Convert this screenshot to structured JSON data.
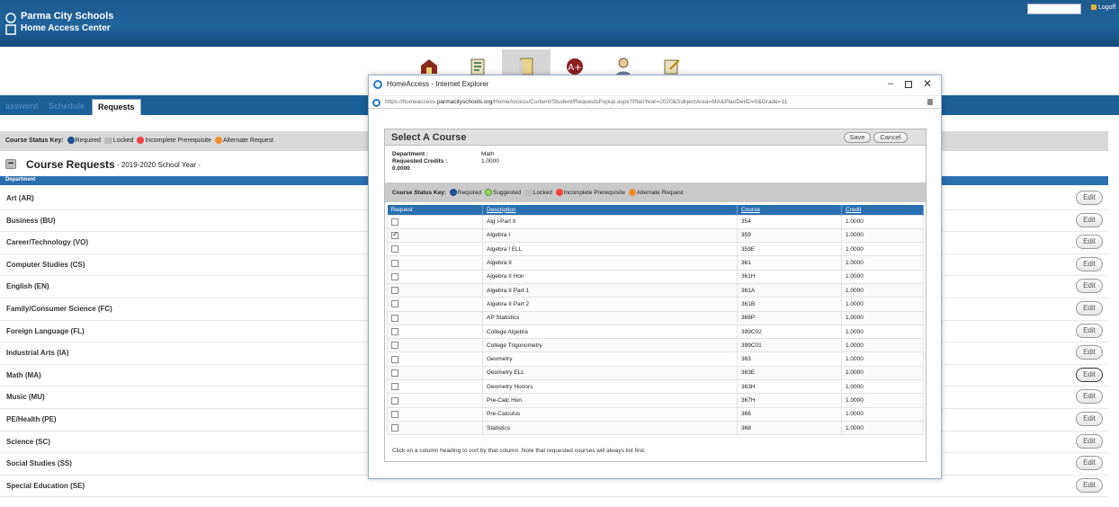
{
  "header": {
    "line1": "Parma City Schools",
    "line2": "Home Access Center",
    "logoff": "Logoff"
  },
  "nav": {
    "items": [
      "home-icon",
      "calendar-icon",
      "classes-icon",
      "grades-icon",
      "registration-icon",
      "requests-icon"
    ],
    "active_index": 2
  },
  "tabs": {
    "password": "assword",
    "schedule": "Schedule",
    "requests": "Requests"
  },
  "status_key": {
    "label": "Course Status Key:",
    "required": "Required",
    "locked": "Locked",
    "incomplete": "Incomplete Prerequisite",
    "alternate": "Alternate Request"
  },
  "course_requests": {
    "title": "Course Requests",
    "year": "- 2019-2020 School Year -",
    "column": "Department",
    "edit_label": "Edit",
    "departments": [
      "Art (AR)",
      "Business (BU)",
      "Career/Technology (VO)",
      "Computer Studies (CS)",
      "English (EN)",
      "Family/Consumer Science (FC)",
      "Foreign Language (FL)",
      "Industrial Arts (IA)",
      "Math (MA)",
      "Music (MU)",
      "PE/Health (PE)",
      "Science (SC)",
      "Social Studies (SS)",
      "Special Education (SE)"
    ]
  },
  "popup": {
    "window_title": "HomeAccess - Internet Explorer",
    "url_prefix": "https://homeaccess.",
    "url_domain": "parmacityschools.org",
    "url_rest": "/HomeAccess/Content/Student/RequestsPopup.aspx?PlanYear=2020&SubjectArea=MA&PlanDetID=0&Grade=11",
    "heading": "Select A Course",
    "save": "Save",
    "cancel": "Cancel",
    "department_label": "Department :",
    "department_value": "Math",
    "credits_label": "Requested Credits :",
    "credits_value": "1.0000",
    "credits_extra": "0.0000",
    "key": {
      "label": "Course Status Key:",
      "required": "Required",
      "suggested": "Suggested",
      "locked": "Locked",
      "incomplete": "Incomplete Prerequisite",
      "alternate": "Alternate Request"
    },
    "columns": [
      "Request",
      "Description",
      "Course",
      "Credit"
    ],
    "courses": [
      {
        "checked": false,
        "description": "Alg I-Part II",
        "course": "354",
        "credit": "1.0000"
      },
      {
        "checked": true,
        "description": "Algebra I",
        "course": "359",
        "credit": "1.0000"
      },
      {
        "checked": false,
        "description": "Algebra I ELL",
        "course": "359E",
        "credit": "1.0000"
      },
      {
        "checked": false,
        "description": "Algebra II",
        "course": "361",
        "credit": "1.0000"
      },
      {
        "checked": false,
        "description": "Algebra II Hon",
        "course": "361H",
        "credit": "1.0000"
      },
      {
        "checked": false,
        "description": "Algebra II Part 1",
        "course": "361A",
        "credit": "1.0000"
      },
      {
        "checked": false,
        "description": "Algebra II Part 2",
        "course": "361B",
        "credit": "1.0000"
      },
      {
        "checked": false,
        "description": "AP Statistics",
        "course": "368P",
        "credit": "1.0000"
      },
      {
        "checked": false,
        "description": "College Algebra",
        "course": "399C02",
        "credit": "1.0000"
      },
      {
        "checked": false,
        "description": "College Trigonometry",
        "course": "399C01",
        "credit": "1.0000"
      },
      {
        "checked": false,
        "description": "Geometry",
        "course": "363",
        "credit": "1.0000"
      },
      {
        "checked": false,
        "description": "Geometry ELL",
        "course": "363E",
        "credit": "1.0000"
      },
      {
        "checked": false,
        "description": "Geometry Honors",
        "course": "363H",
        "credit": "1.0000"
      },
      {
        "checked": false,
        "description": "Pre-Calc Hon",
        "course": "367H",
        "credit": "1.0000"
      },
      {
        "checked": false,
        "description": "Pre-Calculus",
        "course": "366",
        "credit": "1.0000"
      },
      {
        "checked": false,
        "description": "Statistics",
        "course": "368",
        "credit": "1.0000"
      }
    ],
    "footer": "Click on a column heading to sort by that column. Note that requested courses will always list first."
  }
}
